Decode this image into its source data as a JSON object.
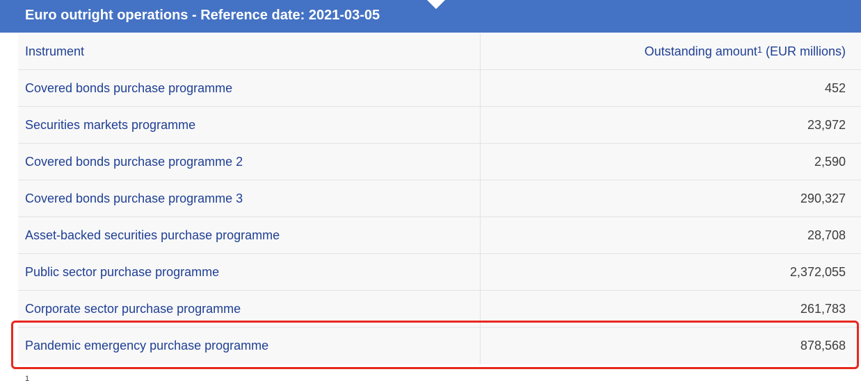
{
  "header": {
    "title": "Euro outright operations - Reference date: 2021-03-05"
  },
  "table": {
    "col_instrument": "Instrument",
    "col_amount_label": "Outstanding amount",
    "col_amount_sup": "1",
    "col_amount_unit": " (EUR millions)",
    "rows": [
      {
        "instrument": "Covered bonds purchase programme",
        "amount": "452"
      },
      {
        "instrument": "Securities markets programme",
        "amount": "23,972"
      },
      {
        "instrument": "Covered bonds purchase programme 2",
        "amount": "2,590"
      },
      {
        "instrument": "Covered bonds purchase programme 3",
        "amount": "290,327"
      },
      {
        "instrument": "Asset-backed securities purchase programme",
        "amount": "28,708"
      },
      {
        "instrument": "Public sector purchase programme",
        "amount": "2,372,055"
      },
      {
        "instrument": "Corporate sector purchase programme",
        "amount": "261,783"
      },
      {
        "instrument": "Pandemic emergency purchase programme",
        "amount": "878,568"
      }
    ]
  },
  "footnote": {
    "marker": "1"
  },
  "highlight": {
    "color": "#e8271f",
    "target_row": "Pandemic emergency purchase programme"
  }
}
